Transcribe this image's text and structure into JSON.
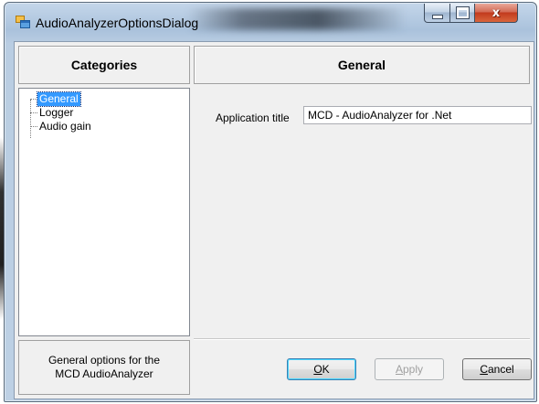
{
  "window": {
    "title": "AudioAnalyzerOptionsDialog",
    "icons": {
      "app": "form-icon",
      "minimize": "minimize-icon",
      "maximize": "maximize-icon",
      "close": "close-icon"
    },
    "close_glyph": "x"
  },
  "categories": {
    "header": "Categories",
    "items": [
      {
        "label": "General",
        "selected": true
      },
      {
        "label": "Logger",
        "selected": false
      },
      {
        "label": "Audio gain",
        "selected": false
      }
    ],
    "description": "General options for the MCD AudioAnalyzer"
  },
  "general": {
    "header": "General",
    "app_title_label": "Application title",
    "app_title_value": "MCD - AudioAnalyzer for .Net"
  },
  "buttons": {
    "ok_mnemonic": "O",
    "ok_rest": "K",
    "apply_mnemonic": "A",
    "apply_rest": "pply",
    "cancel_mnemonic": "C",
    "cancel_rest": "ancel"
  },
  "colors": {
    "selection": "#3399ff",
    "close_button": "#c23a1e",
    "dialog_background": "#f0f0f0"
  }
}
